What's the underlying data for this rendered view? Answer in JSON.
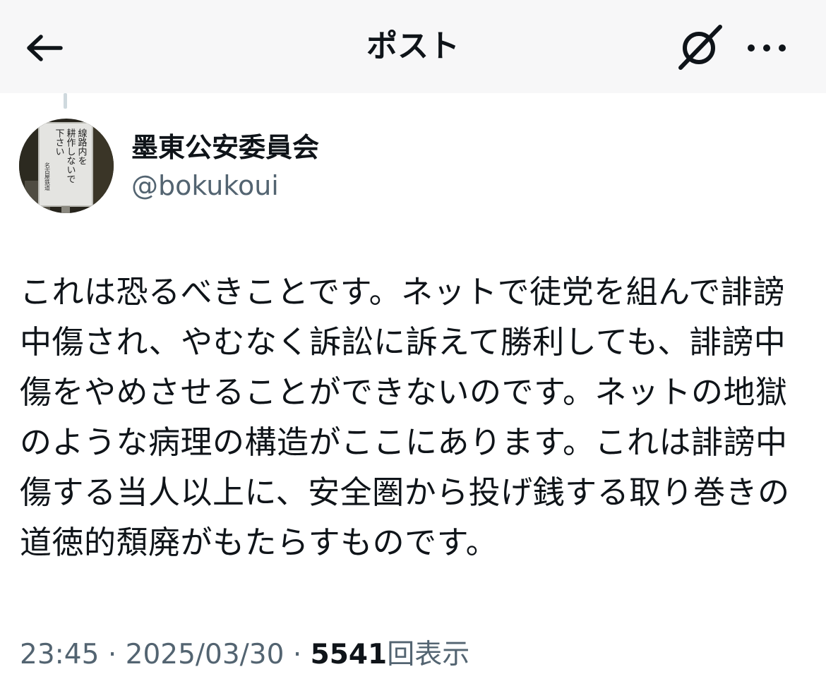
{
  "header": {
    "title": "ポスト",
    "back_icon": "arrow-left-icon",
    "grok_icon": "grok-icon",
    "more_icon": "more-horizontal-icon"
  },
  "author": {
    "display_name": "墨東公安委員会",
    "handle": "@bokukoui",
    "avatar_sign_lines": [
      "線路内を",
      "耕作しないで",
      "下さい"
    ],
    "avatar_sign_footer": "名古屋鉄道"
  },
  "tweet": {
    "text": "これは恐るべきことです。ネットで徒党を組んで誹謗中傷され、やむなく訴訟に訴えて勝利しても、誹謗中傷をやめさせることができないのです。ネットの地獄のような病理の構造がここにあります。これは誹謗中傷する当人以上に、安全圏から投げ銭する取り巻きの道徳的頽廃がもたらすものです。"
  },
  "meta": {
    "time": "23:45",
    "separator": "·",
    "date": "2025/03/30",
    "views_count": "5541",
    "views_label": "回表示"
  },
  "colors": {
    "text_primary": "#0f1419",
    "text_secondary": "#536471",
    "header_bg": "#f7f7f8",
    "thread_line": "#cfd9de"
  }
}
